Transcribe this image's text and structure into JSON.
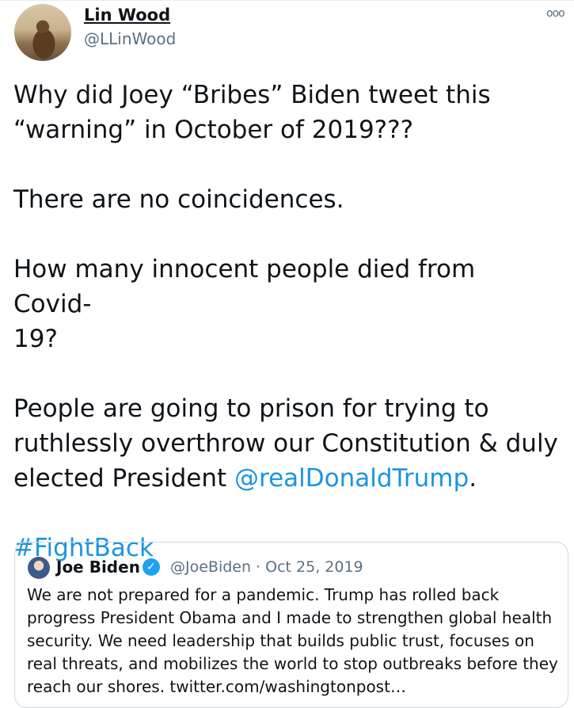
{
  "tweet": {
    "author_name": "Lin Wood",
    "author_handle": "@LLinWood",
    "more_icon": "ooo",
    "text_1": "Why did Joey “Bribes” Biden tweet this\n“warning” in October of 2019???\n\nThere are no coincidences.\n\nHow many innocent people died from Covid-\n19?\n\nPeople are going to prison for trying to\nruthlessly overthrow our Constitution & duly\nelected President ",
    "mention": "@realDonaldTrump",
    "text_2": ".\n\n",
    "hashtag": "#FightBack"
  },
  "quoted_tweet": {
    "author_name": "Joe Biden",
    "verified_mark": "✓",
    "meta": "@JoeBiden · Oct 25, 2019",
    "text": "We are not prepared for a pandemic. Trump has rolled back progress President Obama and I made to strengthen global health security. We need leadership that builds public trust, focuses on real threats, and mobilizes the world to stop outbreaks before they reach our shores. twitter.com/washingtonpost…"
  },
  "colors": {
    "link": "#1b95e0",
    "secondary_text": "#5b7083",
    "verified": "#1da1f2"
  }
}
